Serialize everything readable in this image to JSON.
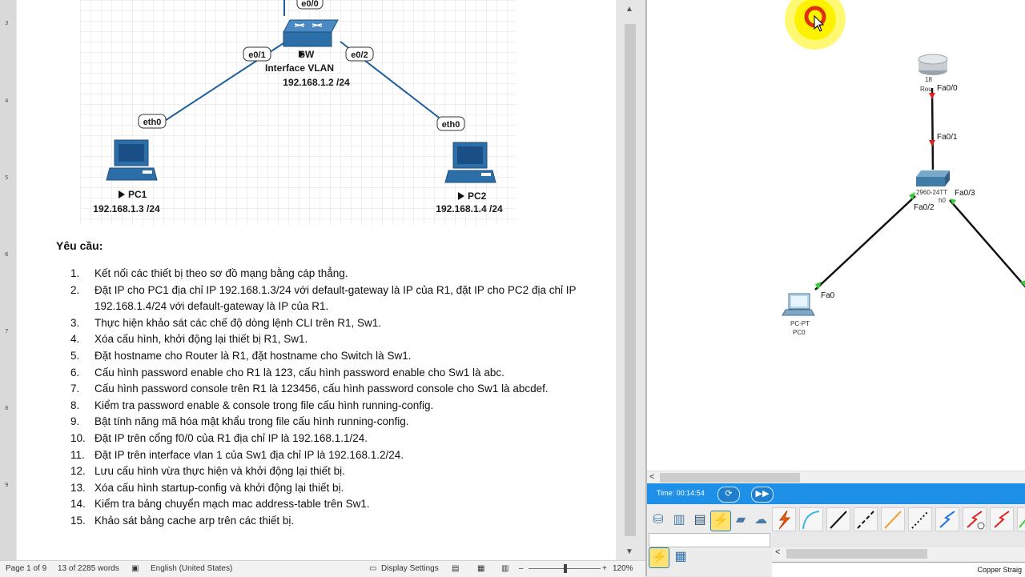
{
  "document": {
    "ruler_ticks": [
      "3",
      "4",
      "5",
      "6",
      "7",
      "8",
      "9"
    ],
    "diagram": {
      "switch_name": "SW",
      "switch_iface": "Interface VLAN",
      "switch_ip": "192.168.1.2 /24",
      "pc1_name": "PC1",
      "pc1_ip": "192.168.1.3 /24",
      "pc2_name": "PC2",
      "pc2_ip": "192.168.1.4 /24",
      "ports": {
        "sw_top": "e0/0",
        "sw_left": "e0/1",
        "sw_right": "e0/2",
        "pc1": "eth0",
        "pc2": "eth0"
      }
    },
    "requirements_title": "Yêu cầu:",
    "requirements": [
      {
        "num": "1.",
        "text": "Kết nối các thiết bị theo sơ đồ mạng bằng cáp thẳng."
      },
      {
        "num": "2.",
        "text": "Đặt IP cho PC1 địa chỉ IP 192.168.1.3/24 với default-gateway là IP của R1, đặt IP cho PC2 địa chỉ IP 192.168.1.4/24 với default-gateway là IP của R1."
      },
      {
        "num": "3.",
        "text": "Thực hiện khảo sát các chế độ dòng lệnh CLI trên R1, Sw1."
      },
      {
        "num": "4.",
        "text": "Xóa cấu hình, khởi động lại thiết bị R1, Sw1."
      },
      {
        "num": "5.",
        "text": "Đặt hostname cho Router là R1, đặt hostname cho Switch là Sw1."
      },
      {
        "num": "6.",
        "text": "Cấu hình password enable cho R1 là 123, cấu hình password enable cho Sw1 là abc."
      },
      {
        "num": "7.",
        "text": "Cấu hình password console trên R1 là 123456, cấu hình password console cho Sw1 là abcdef."
      },
      {
        "num": "8.",
        "text": "Kiểm tra password enable & console trong file cấu hình running-config."
      },
      {
        "num": "9.",
        "text": "Bật tính năng mã hóa mật khẩu trong file cấu hình running-config."
      },
      {
        "num": "10.",
        "text": "Đặt IP trên cổng f0/0 của R1 địa chỉ IP là 192.168.1.1/24."
      },
      {
        "num": "11.",
        "text": "Đặt IP trên interface vlan 1 của Sw1 địa chỉ IP là 192.168.1.2/24."
      },
      {
        "num": "12.",
        "text": "Lưu cấu hình vừa thực hiện và khởi động lại thiết bị."
      },
      {
        "num": "13.",
        "text": "Xóa cấu hình startup-config và khởi động lại thiết bị."
      },
      {
        "num": "14.",
        "text": "Kiểm tra bảng chuyển mạch mac address-table trên Sw1."
      },
      {
        "num": "15.",
        "text": "Khảo sát bảng cache arp trên các thiết bị."
      }
    ]
  },
  "statusbar": {
    "page": "Page 1 of 9",
    "words": "13 of 2285 words",
    "language": "English (United States)",
    "display_settings": "Display Settings",
    "zoom": "120%"
  },
  "packet_tracer": {
    "router_label_1": "18",
    "router_label_2": "Rou",
    "router_port_down": "Fa0/0",
    "switch_port_up": "Fa0/1",
    "switch_model": "2960-24TT",
    "switch_sub": "h0",
    "switch_port_left": "Fa0/2",
    "switch_port_right": "Fa0/3",
    "pc_port": "Fa0",
    "pc_type": "PC-PT",
    "pc_name": "PC0",
    "time": "Time: 00:14:54",
    "cable_name": "Copper Straig",
    "colors": {
      "time_bar": "#1e90e8",
      "link_up": "#3ccc3c",
      "link_down": "#e02020",
      "cursor_halo": "#fff200"
    }
  }
}
